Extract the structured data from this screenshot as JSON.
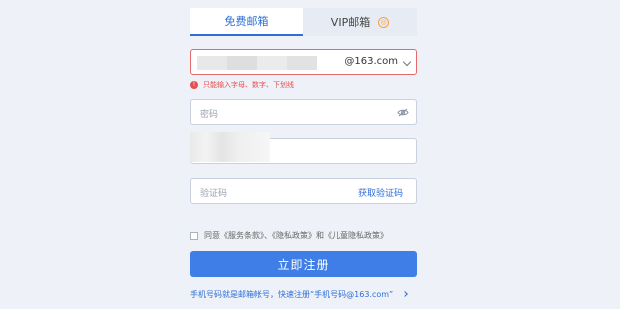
{
  "tabs": {
    "free_label": "免费邮箱",
    "vip_label": "VIP邮箱",
    "vip_badge": "◎"
  },
  "email": {
    "suffix": "@163.com"
  },
  "error": {
    "icon": "!",
    "message": "只能输入字母、数字、下划线"
  },
  "password": {
    "placeholder": "密码"
  },
  "captcha": {
    "placeholder": "验证码",
    "get_code_label": "获取验证码"
  },
  "agreement": {
    "text": "同意《服务条款》、《隐私政策》和《儿童隐私政策》"
  },
  "submit": {
    "label": "立即注册"
  },
  "mobile_tip": {
    "text": "手机号码就是邮箱帐号，快速注册“手机号码@163.com”"
  },
  "colors": {
    "accent": "#3e7ee6",
    "error": "#e55050",
    "background": "#eef1f7"
  },
  "icons": {
    "vip_badge": "vip-crown-icon",
    "dropdown": "chevron-down-icon",
    "error": "error-icon",
    "password_toggle": "eye-hidden-icon",
    "tip_arrow": "chevron-right-icon"
  }
}
